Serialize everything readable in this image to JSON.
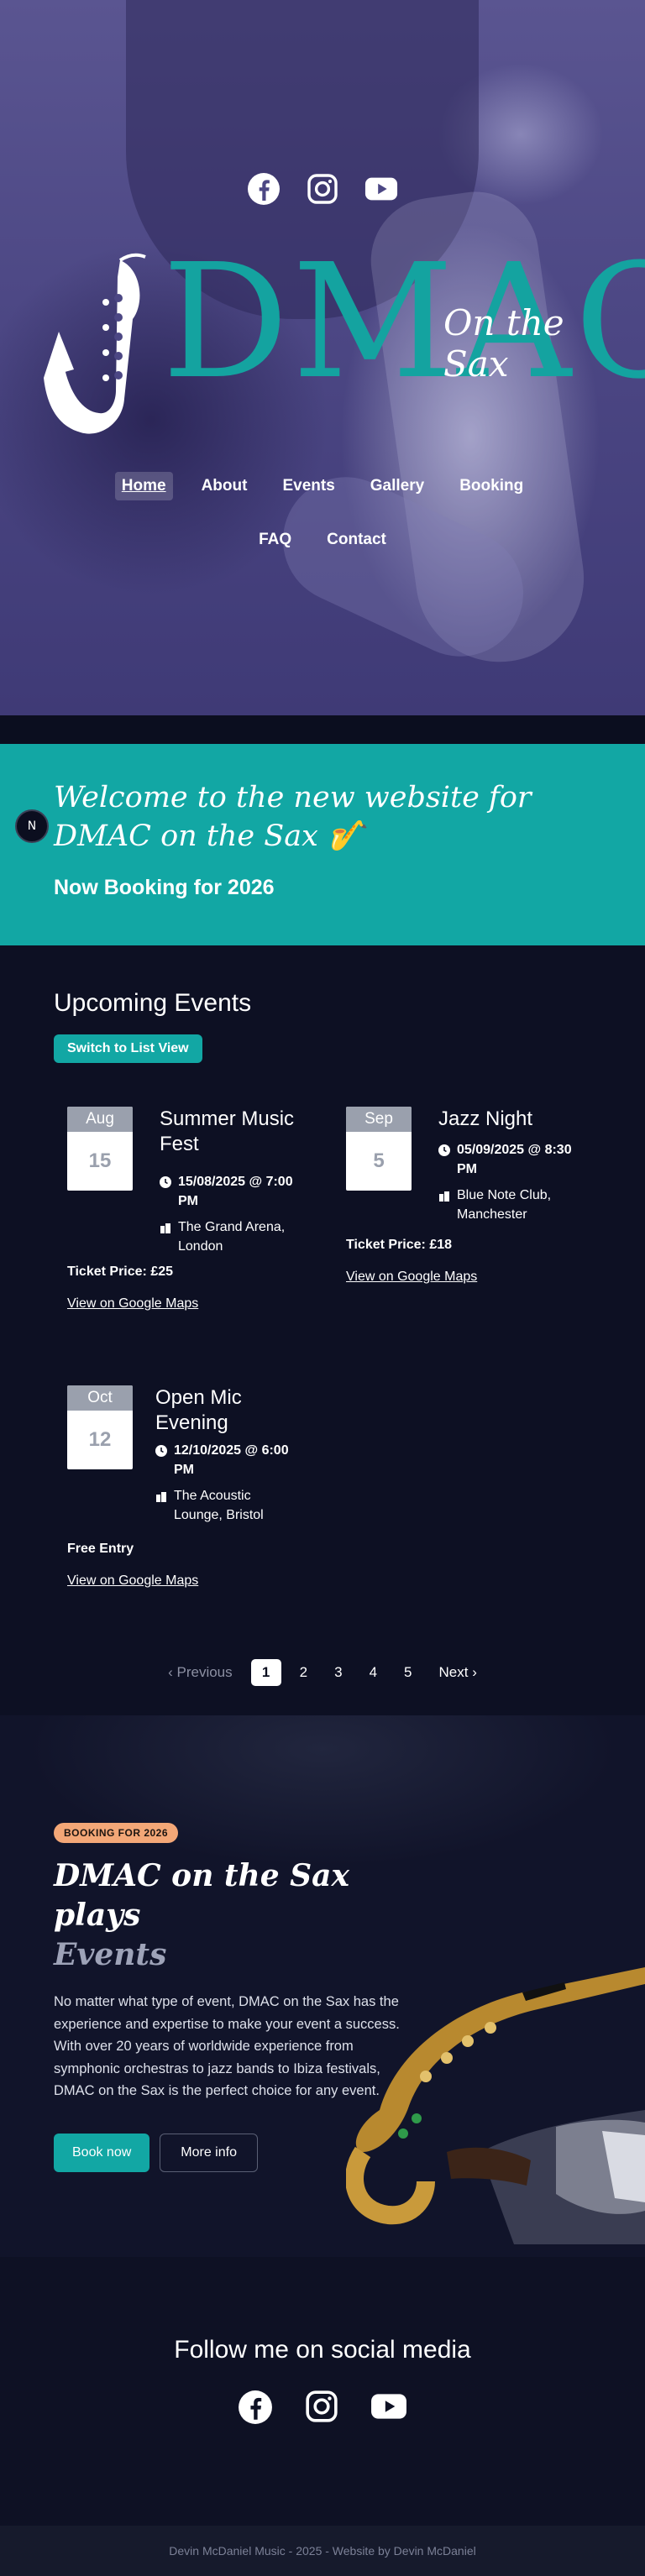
{
  "hero": {
    "social": [
      "facebook-icon",
      "instagram-icon",
      "youtube-icon"
    ],
    "logo_text": "DMAC",
    "logo_sub": "On the Sax"
  },
  "nav": {
    "items": [
      "Home",
      "About",
      "Events",
      "Gallery",
      "Booking",
      "FAQ",
      "Contact"
    ],
    "active": "Home"
  },
  "welcome": {
    "heading": "Welcome to the new website for DMAC on the Sax 🎷",
    "subheading": "Now Booking for 2026",
    "badge": "N"
  },
  "events": {
    "heading": "Upcoming Events",
    "switch_label": "Switch to List View",
    "list": [
      {
        "month": "Aug",
        "day": "15",
        "title": "Summer Music Fest",
        "datetime": "15/08/2025 @ 7:00 PM",
        "venue": "The Grand Arena, London",
        "price": "Ticket Price: £25",
        "map": "View on Google Maps"
      },
      {
        "month": "Sep",
        "day": "5",
        "title": "Jazz Night",
        "datetime": "05/09/2025 @ 8:30 PM",
        "venue": "Blue Note Club, Manchester",
        "price": "Ticket Price: £18",
        "map": "View on Google Maps"
      },
      {
        "month": "Oct",
        "day": "12",
        "title": "Open Mic Evening",
        "datetime": "12/10/2025 @ 6:00 PM",
        "venue": "The Acoustic Lounge, Bristol",
        "price": "Free Entry",
        "map": "View on Google Maps"
      }
    ],
    "pager": {
      "prev": "Previous",
      "pages": [
        "1",
        "2",
        "3",
        "4",
        "5"
      ],
      "current": "1",
      "next": "Next"
    }
  },
  "booking": {
    "badge": "BOOKING FOR 2026",
    "title_main": "DMAC on the Sax plays",
    "title_em": "Events",
    "text": "No matter what type of event, DMAC on the Sax has the experience and expertise to make your event a success. With over 20 years of worldwide experience from symphonic orchestras to jazz bands to Ibiza festivals, DMAC on the Sax is the perfect choice for any event.",
    "primary": "Book now",
    "secondary": "More info"
  },
  "social": {
    "heading": "Follow me on social media",
    "icons": [
      "facebook-icon",
      "instagram-icon",
      "youtube-icon"
    ]
  },
  "footer": {
    "text": "Devin McDaniel Music - 2025 - Website by Devin McDaniel"
  },
  "colors": {
    "teal": "#12a7a4",
    "navy": "#0d1023",
    "badge": "#f3a777",
    "hero": "#4c4784"
  }
}
